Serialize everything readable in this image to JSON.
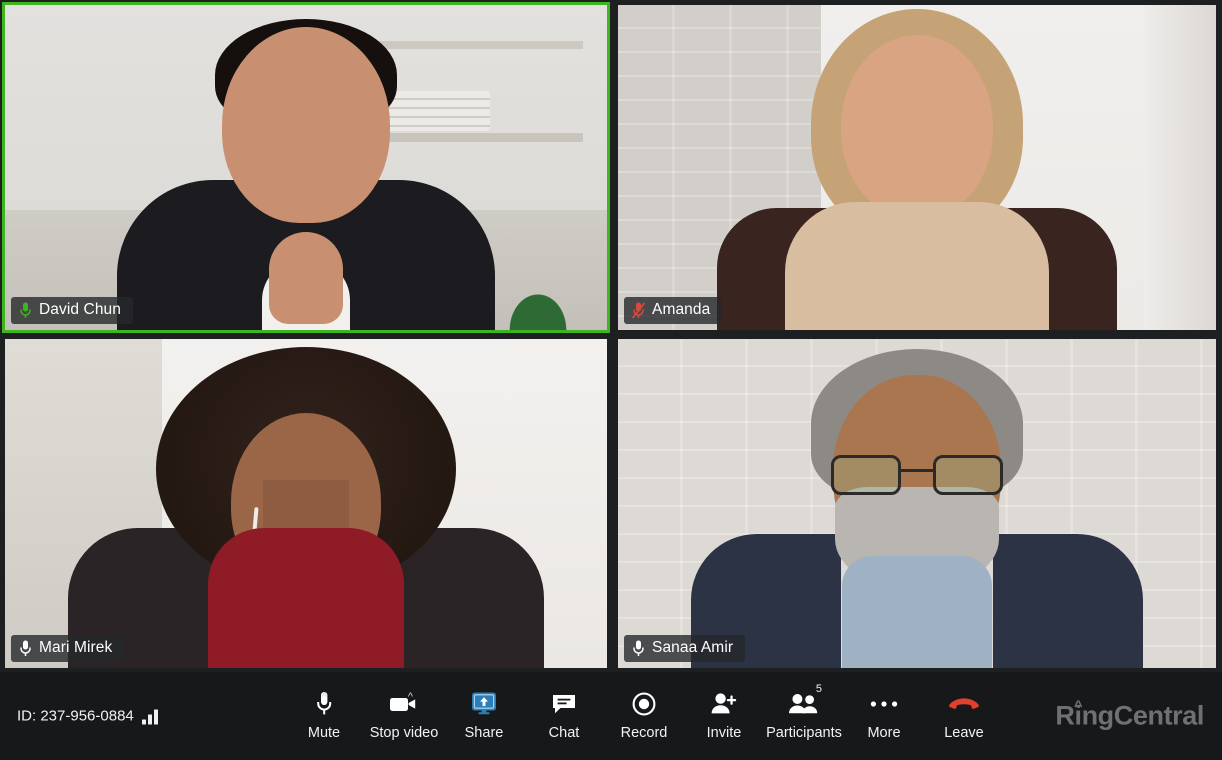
{
  "app": {
    "brand_name": "RingCentral",
    "brand_name_pre": "R",
    "brand_name_i": "i",
    "brand_name_post": "ngCentral",
    "brand_accent_hat": "^"
  },
  "meeting": {
    "id_label": "ID: 237-956-0884",
    "signal_icon": "signal-strength-icon",
    "signal_bars": 3,
    "participant_count": "5"
  },
  "colors": {
    "active_speaker_border": "#3cb521",
    "share_accent": "#2a7fb8",
    "leave_accent": "#e0402e",
    "toolbar_background": "#16181a",
    "stage_background": "#1d1f20",
    "muted_mic": "#d94a3d"
  },
  "participants": [
    {
      "name": "David Chun",
      "mic_state": "unmuted-active",
      "mic_icon": "microphone-icon",
      "active_speaker": true,
      "scene": "s-david"
    },
    {
      "name": "Amanda",
      "mic_state": "muted",
      "mic_icon": "microphone-muted-icon",
      "active_speaker": false,
      "scene": "s-amanda"
    },
    {
      "name": "Mari Mirek",
      "mic_state": "unmuted",
      "mic_icon": "microphone-icon",
      "active_speaker": false,
      "scene": "s-mari"
    },
    {
      "name": "Sanaa Amir",
      "mic_state": "unmuted",
      "mic_icon": "microphone-icon",
      "active_speaker": false,
      "scene": "s-sanaa"
    }
  ],
  "toolbar": {
    "buttons": [
      {
        "label": "Mute",
        "icon": "microphone-icon",
        "has_caret": true,
        "caret": "^"
      },
      {
        "label": "Stop video",
        "icon": "video-camera-icon",
        "has_caret": true,
        "caret": "^"
      },
      {
        "label": "Share",
        "icon": "screen-share-icon",
        "has_caret": false
      },
      {
        "label": "Chat",
        "icon": "chat-bubble-icon",
        "has_caret": false
      },
      {
        "label": "Record",
        "icon": "record-circle-icon",
        "has_caret": false
      },
      {
        "label": "Invite",
        "icon": "person-add-icon",
        "has_caret": false
      },
      {
        "label": "Participants",
        "icon": "people-icon",
        "has_caret": false,
        "badge": "5"
      },
      {
        "label": "More",
        "icon": "ellipsis-icon",
        "has_caret": false
      },
      {
        "label": "Leave",
        "icon": "phone-hangup-icon",
        "has_caret": false
      }
    ]
  }
}
